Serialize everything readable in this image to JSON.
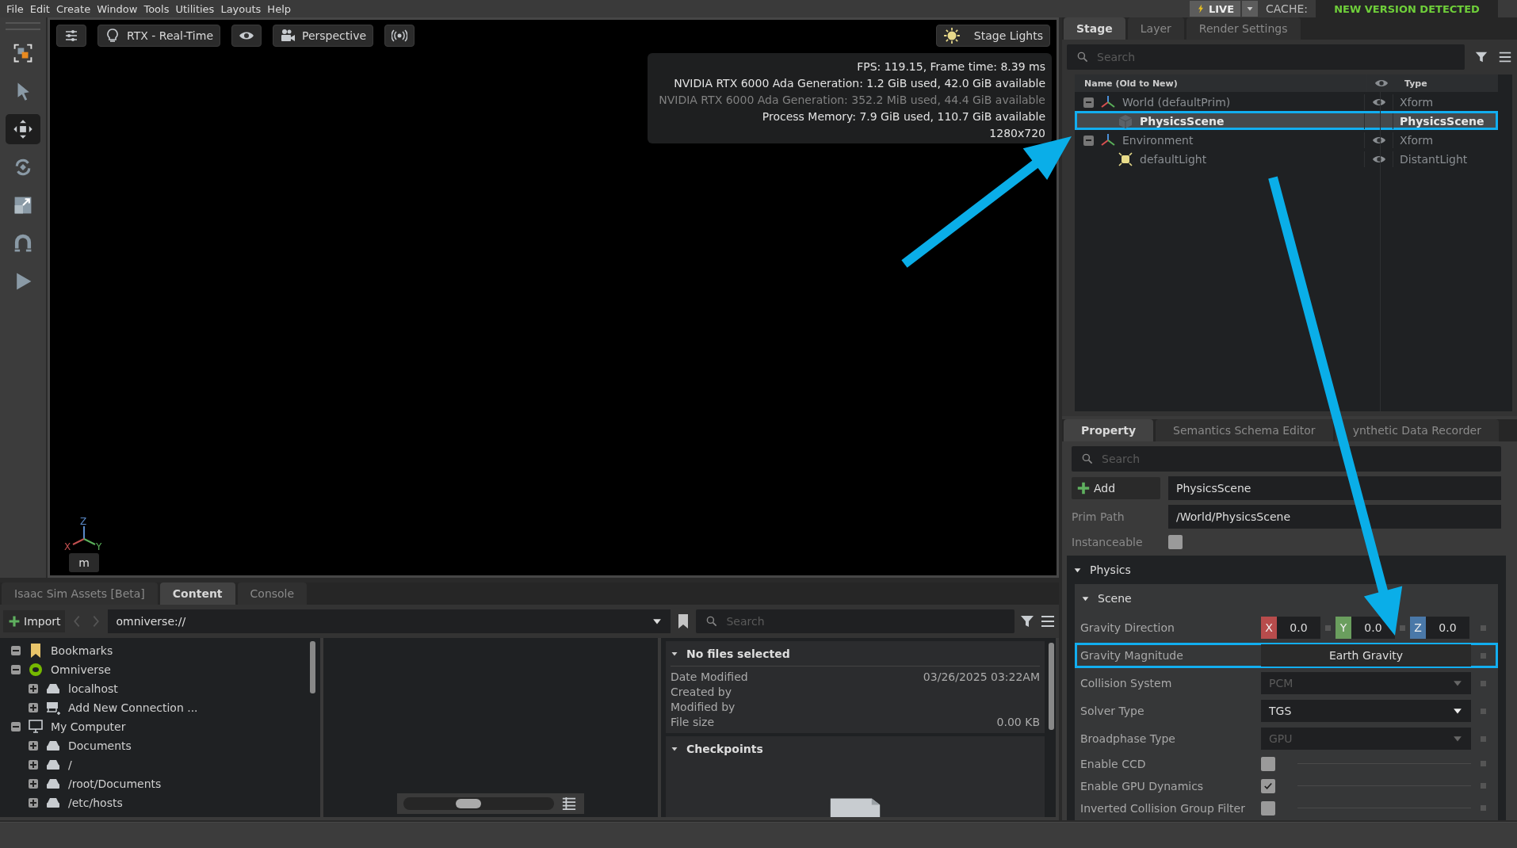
{
  "menu": [
    "File",
    "Edit",
    "Create",
    "Window",
    "Tools",
    "Utilities",
    "Layouts",
    "Help"
  ],
  "live": {
    "label": "LIVE"
  },
  "cache": {
    "label": "CACHE:",
    "status": "NEW VERSION DETECTED"
  },
  "tools": [
    {
      "kind": "select-group",
      "selected": false
    },
    {
      "kind": "select",
      "selected": false
    },
    {
      "kind": "move",
      "selected": true
    },
    {
      "kind": "rotate",
      "selected": false
    },
    {
      "kind": "scale",
      "selected": false
    },
    {
      "kind": "snap",
      "selected": false
    },
    {
      "kind": "play",
      "selected": false
    }
  ],
  "viewport": {
    "toolbar": [
      {
        "kind": "settings"
      },
      {
        "kind": "render",
        "label": "RTX - Real-Time"
      },
      {
        "kind": "visibility"
      },
      {
        "kind": "camera",
        "label": "Perspective"
      },
      {
        "kind": "broadcast"
      }
    ],
    "lights": {
      "label": "Stage Lights"
    },
    "stats": [
      {
        "text": "FPS: 119.15, Frame time: 8.39 ms",
        "dim": false
      },
      {
        "text": "NVIDIA RTX 6000 Ada Generation: 1.2 GiB used, 42.0 GiB available",
        "dim": false
      },
      {
        "text": "NVIDIA RTX 6000 Ada Generation: 352.2 MiB used, 44.4 GiB available",
        "dim": true
      },
      {
        "text": "Process Memory: 7.9 GiB used, 110.7 GiB available",
        "dim": false
      },
      {
        "text": "1280x720",
        "dim": false
      }
    ],
    "axes": [
      "X",
      "Y",
      "Z"
    ],
    "units": "m"
  },
  "stage": {
    "tabs": [
      {
        "label": "Stage",
        "selected": true
      },
      {
        "label": "Layer",
        "selected": false
      },
      {
        "label": "Render Settings",
        "selected": false
      }
    ],
    "search": {
      "placeholder": "Search"
    },
    "columns": [
      "Name (Old to New)",
      "Type"
    ],
    "tree": [
      {
        "name": "World (defaultPrim)",
        "type": "Xform",
        "kind": "xform",
        "visible": true,
        "selected": false,
        "highlighted": false,
        "expanded": true,
        "children": [
          {
            "name": "PhysicsScene",
            "type": "PhysicsScene",
            "kind": "scene",
            "visible": false,
            "selected": true,
            "highlighted": true
          }
        ]
      },
      {
        "name": "Environment",
        "type": "Xform",
        "kind": "xform",
        "visible": true,
        "selected": false,
        "highlighted": false,
        "expanded": true,
        "children": [
          {
            "name": "defaultLight",
            "type": "DistantLight",
            "kind": "light",
            "visible": true,
            "selected": false,
            "highlighted": false
          }
        ]
      }
    ]
  },
  "property": {
    "tabs": [
      {
        "label": "Property",
        "selected": true
      },
      {
        "label": "Semantics Schema Editor",
        "selected": false
      },
      {
        "label": "ynthetic Data Recorder",
        "selected": false
      }
    ],
    "search": {
      "placeholder": "Search"
    },
    "add": "Add",
    "name": "PhysicsScene",
    "prim_path": {
      "label": "Prim Path",
      "value": "/World/PhysicsScene"
    },
    "instanceable": {
      "label": "Instanceable",
      "checked": false
    },
    "section": {
      "title": "Physics",
      "expanded": true,
      "subsection": {
        "title": "Scene",
        "expanded": true,
        "rows": [
          {
            "kind": "vector",
            "label": "Gravity Direction",
            "highlighted": false,
            "components": [
              {
                "axis": "X",
                "value": "0.0",
                "color": "#b84c4c"
              },
              {
                "axis": "Y",
                "value": "0.0",
                "color": "#6a9e5e"
              },
              {
                "axis": "Z",
                "value": "0.0",
                "color": "#4a78a8"
              }
            ]
          },
          {
            "kind": "button",
            "label": "Gravity Magnitude",
            "value": "Earth Gravity",
            "highlighted": true
          },
          {
            "kind": "dropdown",
            "label": "Collision System",
            "value": "PCM",
            "disabled": true,
            "highlighted": false
          },
          {
            "kind": "dropdown",
            "label": "Solver Type",
            "value": "TGS",
            "disabled": false,
            "highlighted": false
          },
          {
            "kind": "dropdown",
            "label": "Broadphase Type",
            "value": "GPU",
            "disabled": true,
            "highlighted": false
          },
          {
            "kind": "checkbox",
            "label": "Enable CCD",
            "checked": false,
            "highlighted": false
          },
          {
            "kind": "checkbox",
            "label": "Enable GPU Dynamics",
            "checked": true,
            "highlighted": false
          },
          {
            "kind": "checkbox",
            "label": "Inverted Collision Group Filter",
            "checked": false,
            "highlighted": false
          }
        ]
      }
    }
  },
  "content": {
    "tabs": [
      {
        "label": "Isaac Sim Assets [Beta]",
        "selected": false
      },
      {
        "label": "Content",
        "selected": true
      },
      {
        "label": "Console",
        "selected": false
      }
    ],
    "import": "Import",
    "path": "omniverse://",
    "search": {
      "placeholder": "Search"
    },
    "tree": [
      {
        "name": "Bookmarks",
        "kind": "bookmark",
        "expanded": true
      },
      {
        "name": "Omniverse",
        "kind": "omniverse",
        "expanded": true,
        "children": [
          {
            "name": "localhost",
            "kind": "drive",
            "expanded": false
          },
          {
            "name": "Add New Connection ...",
            "kind": "add-connection",
            "expanded": false
          }
        ]
      },
      {
        "name": "My Computer",
        "kind": "computer",
        "expanded": true,
        "children": [
          {
            "name": "Documents",
            "kind": "drive",
            "expanded": false
          },
          {
            "name": "/",
            "kind": "drive",
            "expanded": false
          },
          {
            "name": "/root/Documents",
            "kind": "drive",
            "expanded": false
          },
          {
            "name": "/etc/hosts",
            "kind": "drive",
            "expanded": false
          }
        ]
      }
    ],
    "zoom_slider": {
      "level": 0.42
    },
    "details": {
      "title": "No files selected",
      "expanded": true,
      "rows": [
        {
          "label": "Date Modified",
          "value": "03/26/2025 03:22AM"
        },
        {
          "label": "Created by"
        },
        {
          "label": "Modified by"
        },
        {
          "label": "File size",
          "value": "0.00 KB"
        }
      ]
    },
    "checkpoints": {
      "title": "Checkpoints",
      "expanded": true
    }
  }
}
